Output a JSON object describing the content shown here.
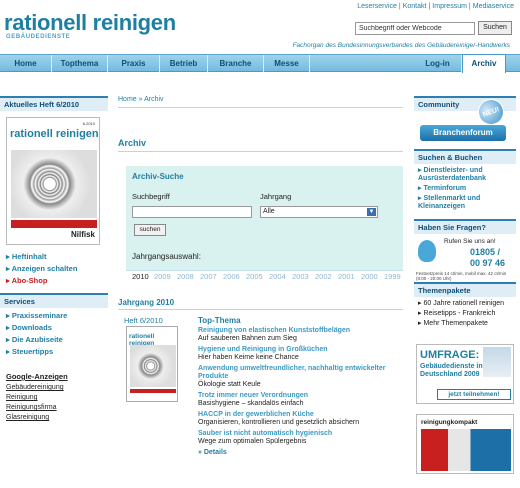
{
  "header": {
    "logo": "rationell reinigen",
    "logo_sub": "GEBÄUDEDIENSTE",
    "top_links": [
      "Leserservice",
      "Kontakt",
      "Impressum",
      "Mediaservice"
    ],
    "search_placeholder": "Suchbegriff oder Webcode",
    "search_button": "Suchen",
    "tagline": "Fachorgan des Bundesinnungsverbandes des Gebäudereiniger-Handwerks"
  },
  "nav": {
    "items": [
      "Home",
      "Topthema",
      "Praxis",
      "Betrieb",
      "Branche",
      "Messe",
      "Log-in",
      "Archiv"
    ],
    "active": "Archiv"
  },
  "left": {
    "current_issue_title": "Aktuelles Heft 6/2010",
    "cover": {
      "title": "rationell reinigen",
      "issue": "6.2010",
      "brand": "Nilfisk"
    },
    "issue_links": [
      {
        "label": "Heftinhalt"
      },
      {
        "label": "Anzeigen schalten"
      },
      {
        "label": "Abo-Shop"
      }
    ],
    "services_title": "Services",
    "services_links": [
      "Praxisseminare",
      "Downloads",
      "Die Azubiseite",
      "Steuertipps"
    ],
    "google_title": "Google-Anzeigen",
    "google_links": [
      "Gebäudereinigung",
      "Reinigung",
      "Reinigungsfirma",
      "Glasreinigung"
    ]
  },
  "main": {
    "breadcrumb": "Home » Archiv",
    "heading": "Archiv",
    "search": {
      "title": "Archiv-Suche",
      "term_label": "Suchbegriff",
      "year_label": "Jahrgang",
      "year_selected": "Alle",
      "button": "suchen",
      "years_label": "Jahrgangsauswahl:",
      "years": [
        "2010",
        "2009",
        "2008",
        "2007",
        "2006",
        "2005",
        "2004",
        "2003",
        "2002",
        "2001",
        "2000",
        "1999"
      ],
      "active_year": "2010"
    },
    "jahrgang_title": "Jahrgang 2010",
    "issue_label": "Heft 6/2010",
    "mini_cover_title": "rationell reinigen",
    "topthema_title": "Top-Thema",
    "topics": [
      {
        "head": "Reinigung von elastischen Kunststoffbelägen",
        "sub": "Auf sauberen Bahnen zum Sieg"
      },
      {
        "head": "Hygiene und Reinigung in Großküchen",
        "sub": "Hier haben Keime keine Chance"
      },
      {
        "head": "Anwendung umweltfreundlicher, nachhaltig entwickelter Produkte",
        "sub": "Ökologie statt Keule"
      },
      {
        "head": "Trotz immer neuer Verordnungen",
        "sub": "Basishygiene – skandalös einfach"
      },
      {
        "head": "HACCP in der gewerblichen Küche",
        "sub": "Organisieren, kontrollieren und gesetzlich absichern"
      },
      {
        "head": "Sauber ist nicht automatisch hygienisch",
        "sub": "Wege zum optimalen Spülergebnis"
      }
    ],
    "details": "» Details"
  },
  "right": {
    "community_title": "Community",
    "branchenforum": "Branchenforum",
    "neu": "NEU!",
    "suchen_title": "Suchen & Buchen",
    "suchen_links": [
      "Dienstleister- und Ausrüsterdatenbank",
      "Terminforum",
      "Stellenmarkt und Kleinanzeigen"
    ],
    "help_title": "Haben Sie Fragen?",
    "help_call": "Rufen Sie uns an!",
    "help_num1": "01805 /",
    "help_num2": "00 97 46",
    "help_note": "Festnetzpreis 14 ct/min, mobil max. 42 ct/min (8:00 - 20:00 Uhr)",
    "themen_title": "Themenpakete",
    "themen_links": [
      "60 Jahre rationell reinigen",
      "Reisetipps - Frankreich",
      "Mehr Themenpakete"
    ],
    "ad1": {
      "title": "UMFRAGE:",
      "sub": "Gebäudedienste in Deutschland 2009",
      "button": "jetzt teilnehmen!"
    },
    "ad2": {
      "title": "reinigungkompakt"
    }
  }
}
